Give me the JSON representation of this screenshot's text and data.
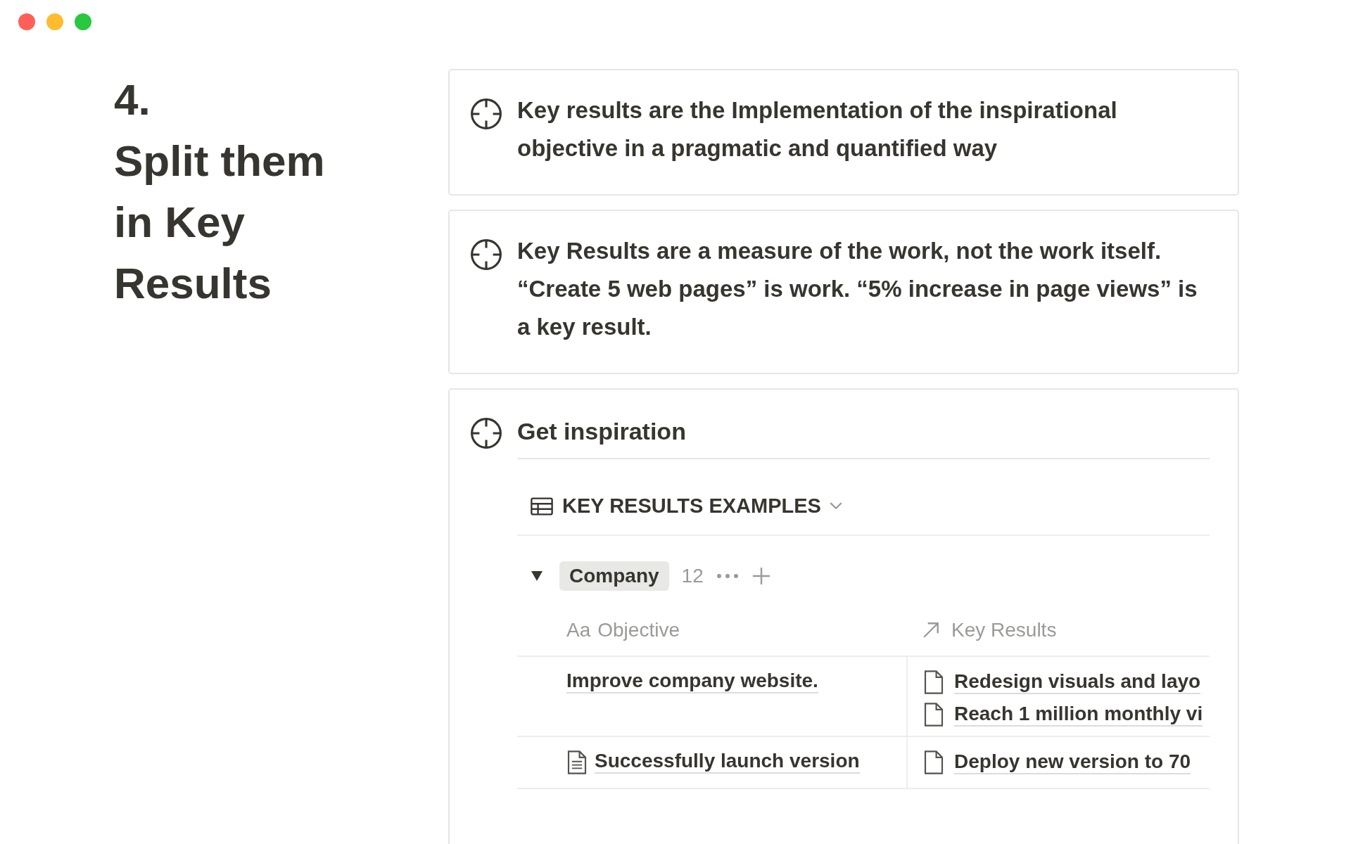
{
  "window": {
    "controls": [
      {
        "color": "#ff5f57"
      },
      {
        "color": "#febc2e"
      },
      {
        "color": "#28c840"
      }
    ]
  },
  "heading": {
    "number": "4.",
    "title": "Split them in Key Results"
  },
  "callouts": [
    {
      "text": "Key results are the Implementation of the inspirational objective in a pragmatic and quantified way"
    },
    {
      "text": "Key Results are a measure of the work, not the work itself. “Create 5 web pages” is work. “5% increase in page views” is a key result."
    }
  ],
  "inspiration": {
    "title": "Get inspiration",
    "database": {
      "title": "KEY RESULTS EXAMPLES",
      "group": {
        "label": "Company",
        "count": "12",
        "expanded": true
      },
      "columns": [
        {
          "type_label": "Aa",
          "label": "Objective"
        },
        {
          "label": "Key Results"
        }
      ],
      "rows": [
        {
          "objective": {
            "text": "Improve company website.",
            "page_icon": false
          },
          "key_results": [
            "Redesign visuals and layo",
            "Reach 1 million monthly vi"
          ]
        },
        {
          "objective": {
            "text": "Successfully launch version",
            "page_icon": true
          },
          "key_results": [
            "Deploy new version to 70"
          ]
        }
      ]
    }
  }
}
